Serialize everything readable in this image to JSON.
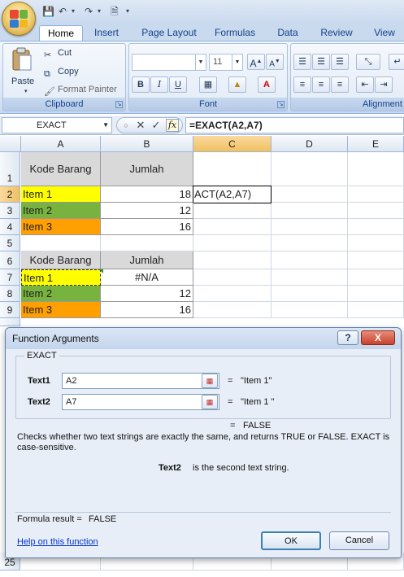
{
  "ribbon": {
    "tabs": [
      "Home",
      "Insert",
      "Page Layout",
      "Formulas",
      "Data",
      "Review",
      "View"
    ],
    "active_tab": "Home",
    "clipboard": {
      "paste": "Paste",
      "cut": "Cut",
      "copy": "Copy",
      "format_painter": "Format Painter",
      "label": "Clipboard"
    },
    "font": {
      "font_name": "",
      "font_size": "11",
      "label": "Font"
    },
    "alignment": {
      "label": "Alignment"
    }
  },
  "formula_bar": {
    "name_box": "EXACT",
    "formula": "=EXACT(A2,A7)"
  },
  "grid": {
    "columns": [
      "A",
      "B",
      "C",
      "D",
      "E"
    ],
    "selected_column": "C",
    "rows": [
      {
        "num": "1",
        "a": "Kode Barang",
        "b": "Jumlah",
        "c": ""
      },
      {
        "num": "2",
        "a": "Item 1",
        "b": "18",
        "c": "ACT(A2,A7)"
      },
      {
        "num": "3",
        "a": "Item 2",
        "b": "12",
        "c": ""
      },
      {
        "num": "4",
        "a": "Item 3",
        "b": "16",
        "c": ""
      },
      {
        "num": "5",
        "a": "",
        "b": "",
        "c": ""
      },
      {
        "num": "6",
        "a": "Kode Barang",
        "b": "Jumlah",
        "c": ""
      },
      {
        "num": "7",
        "a": "Item 1",
        "b": "#N/A",
        "c": ""
      },
      {
        "num": "8",
        "a": "Item 2",
        "b": "12",
        "c": ""
      },
      {
        "num": "9",
        "a": "Item 3",
        "b": "16",
        "c": ""
      },
      {
        "num": "25",
        "a": "",
        "b": "",
        "c": ""
      }
    ],
    "colors": {
      "header_fill": "#d9d9d9",
      "item1_fill": "#ffff00",
      "item2_fill": "#77b33e",
      "item3_fill": "#ff9f00"
    }
  },
  "dialog": {
    "title": "Function Arguments",
    "help_button": "?",
    "close_button": "X",
    "function_name": "EXACT",
    "args": [
      {
        "label": "Text1",
        "value": "A2",
        "equals": "=",
        "result": "\"Item 1\""
      },
      {
        "label": "Text2",
        "value": "A7",
        "equals": "=",
        "result": "\"Item 1 \""
      }
    ],
    "overall_equals": "=",
    "overall_result": "FALSE",
    "description": "Checks whether two text strings are exactly the same, and returns TRUE or FALSE. EXACT is case-sensitive.",
    "arg_help_name": "Text2",
    "arg_help_text": "is the second text string.",
    "formula_result_label": "Formula result =",
    "formula_result_value": "FALSE",
    "help_link": "Help on this function",
    "ok": "OK",
    "cancel": "Cancel"
  }
}
